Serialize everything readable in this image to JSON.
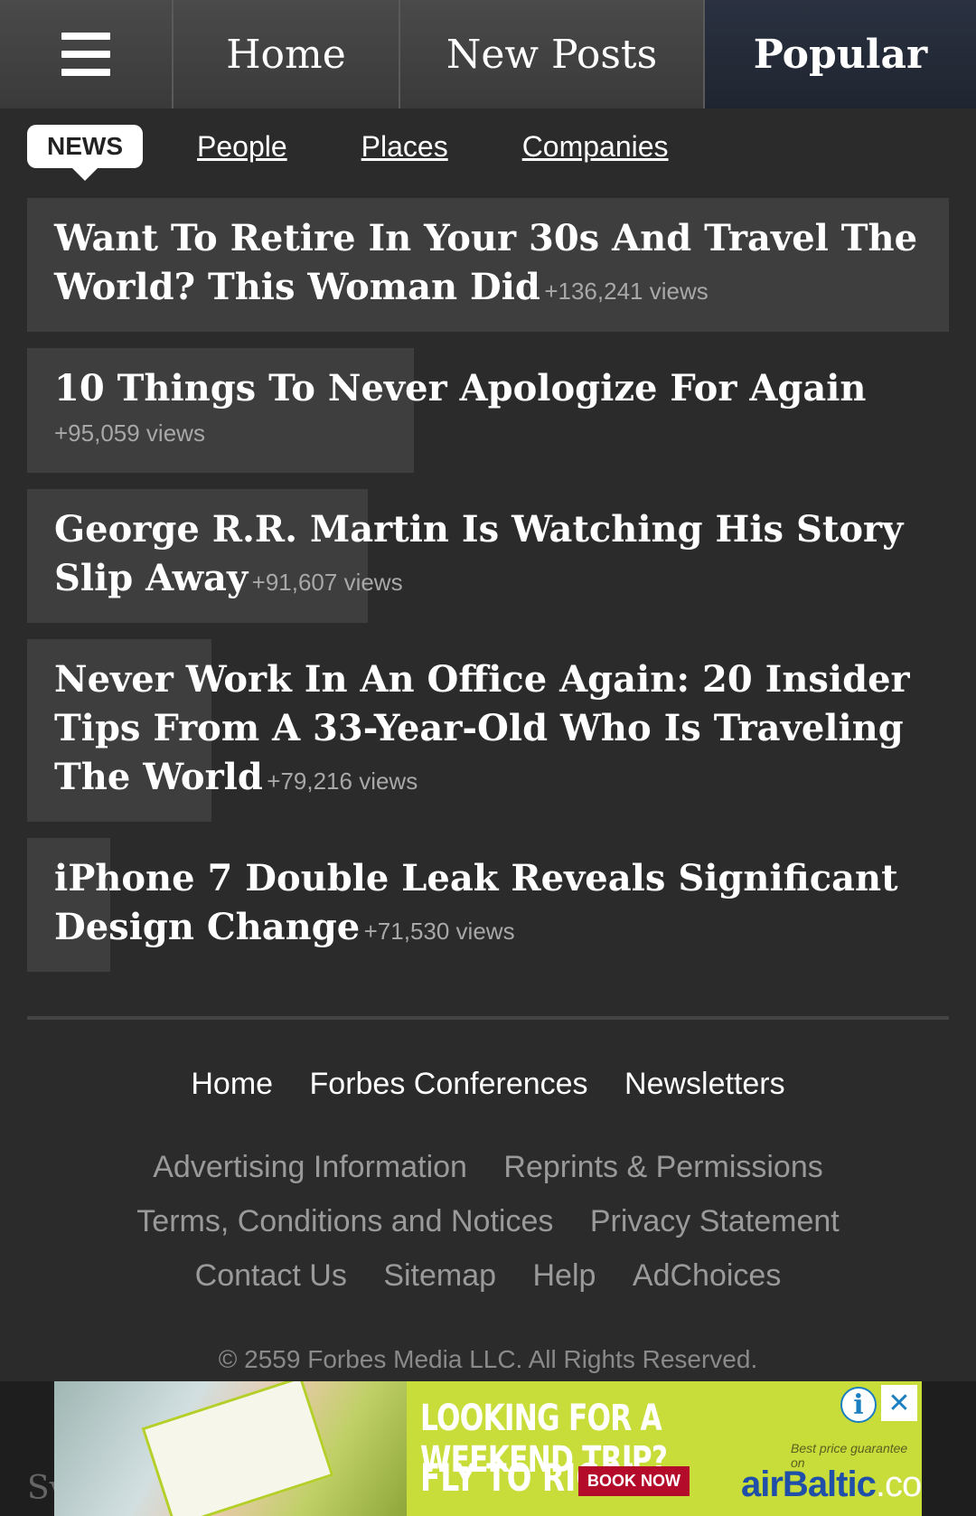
{
  "topnav": {
    "home": "Home",
    "new_posts": "New Posts",
    "popular": "Popular"
  },
  "subtabs": {
    "news": "NEWS",
    "people": "People",
    "places": "Places",
    "companies": "Companies"
  },
  "articles": [
    {
      "title": "Want To Retire In Your 30s And Travel The World? This Woman Did",
      "views": "+136,241 views",
      "popularity": 1.0
    },
    {
      "title": "10 Things To Never Apologize For Again",
      "views": "+95,059 views",
      "popularity": 0.42
    },
    {
      "title": "George R.R. Martin Is Watching His Story Slip Away",
      "views": "+91,607 views",
      "popularity": 0.37
    },
    {
      "title": "Never Work In An Office Again: 20 Insider Tips From A 33-Year-Old Who Is Traveling The World",
      "views": "+79,216 views",
      "popularity": 0.2
    },
    {
      "title": "iPhone 7 Double Leak Reveals Significant Design Change",
      "views": "+71,530 views",
      "popularity": 0.09
    }
  ],
  "footer": {
    "main_links": [
      "Home",
      "Forbes Conferences",
      "Newsletters"
    ],
    "row1": [
      "Advertising Information",
      "Reprints & Permissions"
    ],
    "row2": [
      "Terms, Conditions and Notices",
      "Privacy Statement"
    ],
    "row3": [
      "Contact Us",
      "Sitemap",
      "Help",
      "AdChoices"
    ],
    "copyright": "© 2559 Forbes Media LLC. All Rights Reserved."
  },
  "bottom_strip_text": "Sv",
  "ad": {
    "headline1": "LOOKING FOR A WEEKEND TRIP?",
    "headline2": "FLY TO RIGA!",
    "book_now": "BOOK NOW",
    "guarantee": "Best price guarantee on",
    "brand": "airBaltic",
    "brand_suffix": ".com",
    "info_icon": "info-icon",
    "close_icon": "close-icon",
    "accent_color": "#c8dc3a"
  }
}
